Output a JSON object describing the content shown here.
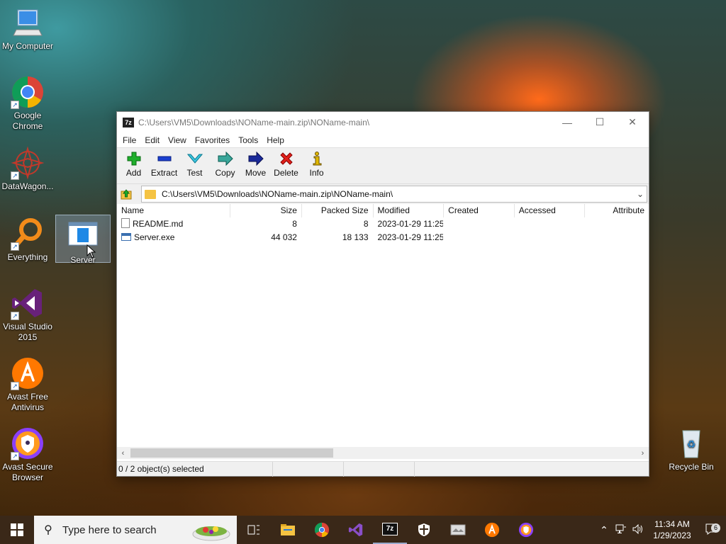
{
  "desktop": {
    "icons": [
      {
        "label": "My Computer"
      },
      {
        "label": "Google Chrome"
      },
      {
        "label": "DataWagon..."
      },
      {
        "label": "Everything"
      },
      {
        "label": "Server"
      },
      {
        "label": "Visual Studio 2015"
      },
      {
        "label": "Avast Free Antivirus"
      },
      {
        "label": "Avast Secure Browser"
      },
      {
        "label": "Recycle Bin"
      }
    ]
  },
  "window": {
    "logo": "7z",
    "title": "C:\\Users\\VM5\\Downloads\\NOName-main.zip\\NOName-main\\",
    "menu": [
      "File",
      "Edit",
      "View",
      "Favorites",
      "Tools",
      "Help"
    ],
    "toolbar": [
      "Add",
      "Extract",
      "Test",
      "Copy",
      "Move",
      "Delete",
      "Info"
    ],
    "address": "C:\\Users\\VM5\\Downloads\\NOName-main.zip\\NOName-main\\",
    "columns": [
      "Name",
      "Size",
      "Packed Size",
      "Modified",
      "Created",
      "Accessed",
      "Attribute"
    ],
    "rows": [
      {
        "name": "README.md",
        "size": "8",
        "packed": "8",
        "modified": "2023-01-29 11:25",
        "created": "",
        "accessed": "",
        "attr": ""
      },
      {
        "name": "Server.exe",
        "size": "44 032",
        "packed": "18 133",
        "modified": "2023-01-29 11:25",
        "created": "",
        "accessed": "",
        "attr": ""
      }
    ],
    "status": "0 / 2 object(s) selected"
  },
  "taskbar": {
    "search_placeholder": "Type here to search",
    "time": "11:34 AM",
    "date": "1/29/2023",
    "notification_count": "6",
    "pinned_7z_label": "7z"
  },
  "colors": {
    "accent_orange": "#ff6a1a",
    "taskbar": "#3a2818",
    "folder": "#f5c342"
  }
}
